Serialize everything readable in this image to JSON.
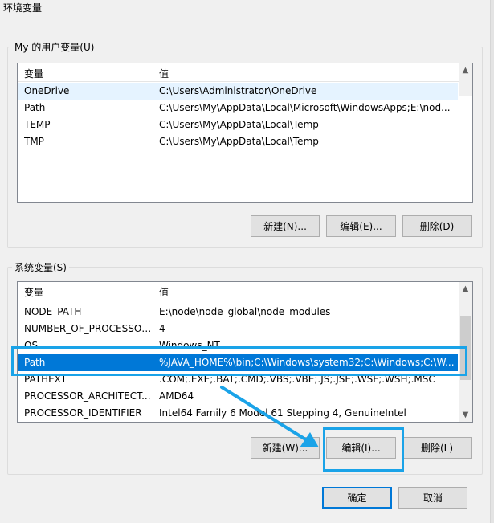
{
  "window": {
    "title": "环境变量"
  },
  "user_vars": {
    "legend": "My 的用户变量(U)",
    "col_name": "变量",
    "col_value": "值",
    "rows": [
      {
        "name": "OneDrive",
        "value": "C:\\Users\\Administrator\\OneDrive"
      },
      {
        "name": "Path",
        "value": "C:\\Users\\My\\AppData\\Local\\Microsoft\\WindowsApps;E:\\nod..."
      },
      {
        "name": "TEMP",
        "value": "C:\\Users\\My\\AppData\\Local\\Temp"
      },
      {
        "name": "TMP",
        "value": "C:\\Users\\My\\AppData\\Local\\Temp"
      }
    ],
    "new_label": "新建(N)...",
    "edit_label": "编辑(E)...",
    "delete_label": "删除(D)"
  },
  "system_vars": {
    "legend": "系统变量(S)",
    "col_name": "变量",
    "col_value": "值",
    "rows": [
      {
        "name": "NODE_PATH",
        "value": "E:\\node\\node_global\\node_modules"
      },
      {
        "name": "NUMBER_OF_PROCESSORS",
        "value": "4"
      },
      {
        "name": "OS",
        "value": "Windows_NT"
      },
      {
        "name": "Path",
        "value": "%JAVA_HOME%\\bin;C:\\Windows\\system32;C:\\Windows;C:\\W..."
      },
      {
        "name": "PATHEXT",
        "value": ".COM;.EXE;.BAT;.CMD;.VBS;.VBE;.JS;.JSE;.WSF;.WSH;.MSC"
      },
      {
        "name": "PROCESSOR_ARCHITECT...",
        "value": "AMD64"
      },
      {
        "name": "PROCESSOR_IDENTIFIER",
        "value": "Intel64 Family 6 Model 61 Stepping 4, GenuineIntel"
      }
    ],
    "selected_row": "Path",
    "new_label": "新建(W)...",
    "edit_label": "编辑(I)...",
    "delete_label": "删除(L)"
  },
  "footer": {
    "ok_label": "确定",
    "cancel_label": "取消"
  },
  "icons": {
    "scroll_up": "▲",
    "scroll_down": "▼"
  },
  "colors": {
    "selection": "#0078d7",
    "annotation": "#1aa3e8"
  }
}
